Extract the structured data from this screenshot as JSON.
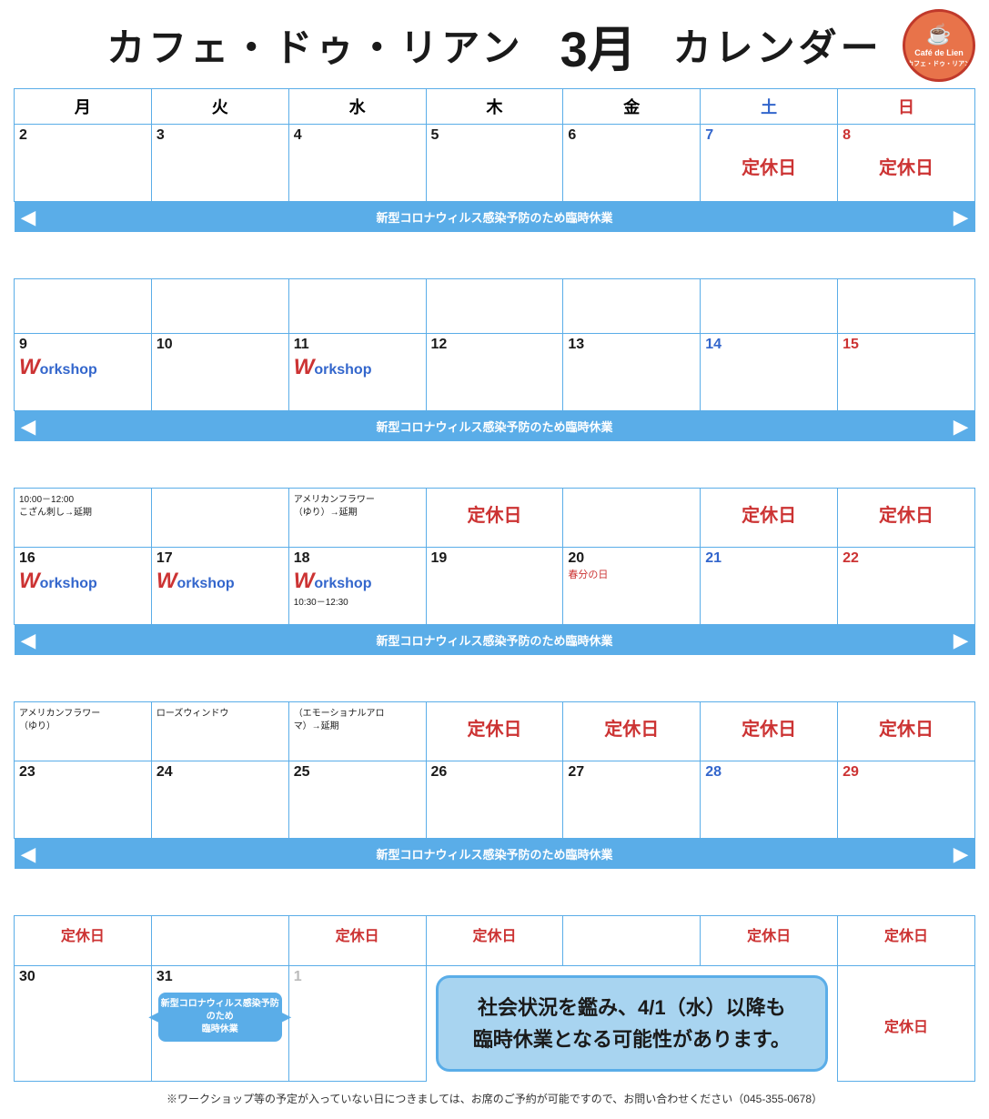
{
  "header": {
    "cafe_name": "カフェ・ドゥ・リアン",
    "month": "3月",
    "calendar": "カレンダー",
    "logo_text": "Café de Lien",
    "logo_sub": "カフェ・ドゥ・リアン"
  },
  "day_headers": [
    {
      "label": "月",
      "class": ""
    },
    {
      "label": "火",
      "class": ""
    },
    {
      "label": "水",
      "class": ""
    },
    {
      "label": "木",
      "class": ""
    },
    {
      "label": "金",
      "class": ""
    },
    {
      "label": "土",
      "class": "sat"
    },
    {
      "label": "日",
      "class": "sun"
    }
  ],
  "banner_text": "新型コロナウィルス感染予防のため臨時休業",
  "teikyu": "定休日",
  "workshop": "Workshop",
  "weeks": [
    {
      "cells": [
        {
          "num": "2",
          "type": "normal",
          "content": ""
        },
        {
          "num": "3",
          "type": "normal",
          "content": ""
        },
        {
          "num": "4",
          "type": "normal",
          "content": ""
        },
        {
          "num": "5",
          "type": "normal",
          "content": ""
        },
        {
          "num": "6",
          "type": "normal",
          "content": ""
        },
        {
          "num": "7",
          "type": "sat",
          "content": "teikyu"
        },
        {
          "num": "8",
          "type": "sun",
          "content": "teikyu"
        }
      ],
      "has_banner": true
    },
    {
      "cells": [
        {
          "num": "9",
          "type": "normal",
          "content": "workshop",
          "detail": "10:00－12:00\nこざん刺し→延期"
        },
        {
          "num": "10",
          "type": "normal",
          "content": ""
        },
        {
          "num": "11",
          "type": "normal",
          "content": "workshop",
          "detail": "アメリカンフラワー\n（ゆり）→延期"
        },
        {
          "num": "12",
          "type": "normal",
          "content": "teikyu"
        },
        {
          "num": "13",
          "type": "normal",
          "content": ""
        },
        {
          "num": "14",
          "type": "sat",
          "content": "teikyu"
        },
        {
          "num": "15",
          "type": "sun",
          "content": "teikyu"
        }
      ],
      "has_banner": true
    },
    {
      "cells": [
        {
          "num": "16",
          "type": "normal",
          "content": "workshop",
          "detail": "アメリカンフラワー\n（ゆり）"
        },
        {
          "num": "17",
          "type": "normal",
          "content": "workshop",
          "detail": "ローズウィンドウ"
        },
        {
          "num": "18",
          "type": "normal",
          "content": "workshop",
          "detail": "10:30－12:30\n（エモーショナルアロ\nマ）→延期"
        },
        {
          "num": "19",
          "type": "normal",
          "content": "teikyu"
        },
        {
          "num": "20",
          "type": "normal",
          "content": "teikyu",
          "sub": "春分の日"
        },
        {
          "num": "21",
          "type": "sat",
          "content": "teikyu"
        },
        {
          "num": "22",
          "type": "sun",
          "content": "teikyu"
        }
      ],
      "has_banner": true
    },
    {
      "cells": [
        {
          "num": "23",
          "type": "normal",
          "content": "teikyu"
        },
        {
          "num": "24",
          "type": "normal",
          "content": ""
        },
        {
          "num": "25",
          "type": "normal",
          "content": "teikyu"
        },
        {
          "num": "26",
          "type": "normal",
          "content": "teikyu"
        },
        {
          "num": "27",
          "type": "normal",
          "content": ""
        },
        {
          "num": "28",
          "type": "sat",
          "content": "teikyu"
        },
        {
          "num": "29",
          "type": "sun",
          "content": "teikyu"
        }
      ],
      "has_banner": true
    },
    {
      "cells": [
        {
          "num": "30",
          "type": "normal",
          "content": "closure_mini",
          "colspan": 2
        },
        {
          "num": "31",
          "type": "normal",
          "content": ""
        },
        {
          "num": "1",
          "type": "gray",
          "content": "notice"
        },
        {
          "num": "",
          "type": "notice",
          "content": "notice"
        },
        {
          "num": "",
          "type": "",
          "content": ""
        },
        {
          "num": "",
          "type": "sun",
          "content": "teikyu"
        }
      ],
      "has_banner": false
    }
  ],
  "notice_text_line1": "社会状況を鑑み、4/1（水）以降も",
  "notice_text_line2": "臨時休業となる可能性があります。",
  "closure_mini_text": "新型コロナウィルス感染予防のため\n臨時休業",
  "footer": "※ワークショップ等の予定が入っていない日につきましては、お席のご予約が可能ですので、お問い合わせください（045-355-0678）"
}
